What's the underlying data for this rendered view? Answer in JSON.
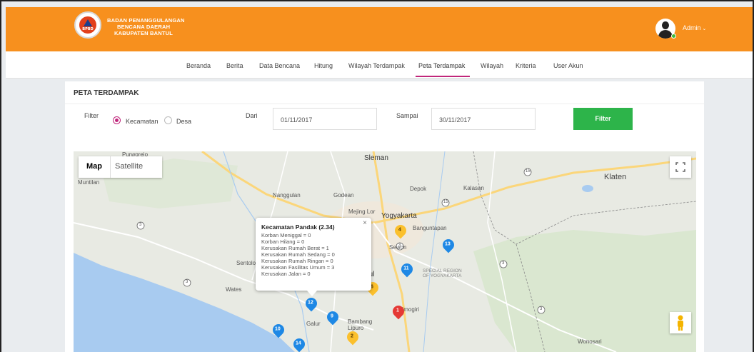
{
  "header": {
    "brand_lines": [
      "BADAN PENANGGULANGAN",
      "BENCANA DAERAH",
      "KABUPATEN BANTUL"
    ],
    "logo_text": "BPBD",
    "user_label": "Admin"
  },
  "nav": {
    "items": [
      {
        "label": "Beranda"
      },
      {
        "label": "Berita"
      },
      {
        "label": "Data Bencana"
      },
      {
        "label": "Hitung"
      },
      {
        "label": "Wilayah Terdampak"
      },
      {
        "label": "Peta Terdampak"
      },
      {
        "label": "Wilayah"
      },
      {
        "label": "Kriteria"
      },
      {
        "label": "User Akun"
      }
    ],
    "active": "Peta Terdampak",
    "accent_color": "#c0267b"
  },
  "page": {
    "title": "PETA TERDAMPAK",
    "filter_label": "Filter",
    "radio_kecamatan": "Kecamatan",
    "radio_desa": "Desa",
    "selected_level": "Kecamatan",
    "dari_label": "Dari",
    "dari_value": "01/11/2017",
    "sampai_label": "Sampai",
    "sampai_value": "30/11/2017",
    "filter_button": "Filter"
  },
  "map": {
    "type_map": "Map",
    "type_satellite": "Satellite",
    "selected_type": "Map",
    "places": [
      "Purworejo",
      "Muntilan",
      "Sleman",
      "Klaten",
      "Depok",
      "Kalasan",
      "Nanggulan",
      "Godean",
      "Mejing Lor",
      "Yogyakarta",
      "Banguntapan",
      "Sewon",
      "Sentolo",
      "Wates",
      "Bantul",
      "Galur",
      "Bambang Lipuro",
      "Imogiri",
      "Wonosari"
    ],
    "special_region": [
      "SPECIAL REGION",
      "OF YOGYAKARTA"
    ],
    "road_shields": [
      "15",
      "15",
      "3",
      "3",
      "3",
      "3",
      "3"
    ],
    "markers": [
      {
        "label": "4",
        "color": "yellow"
      },
      {
        "label": "13",
        "color": "blue"
      },
      {
        "label": "11",
        "color": "blue"
      },
      {
        "label": "6",
        "color": "yellow"
      },
      {
        "label": "12",
        "color": "blue"
      },
      {
        "label": "9",
        "color": "blue"
      },
      {
        "label": "1",
        "color": "red"
      },
      {
        "label": "10",
        "color": "blue"
      },
      {
        "label": "2",
        "color": "yellow"
      },
      {
        "label": "14",
        "color": "blue"
      }
    ],
    "marker_colors": {
      "blue": "#1e88e5",
      "yellow": "#fbc02d",
      "red": "#e53935"
    },
    "popup": {
      "title": "Kecamatan Pandak (2.34)",
      "lines": [
        "Korban Meniggal = 0",
        "Korban Hilang = 0",
        "Kerusakan Rumah Berat = 1",
        "Kerusakan Rumah Sedang = 0",
        "Kerusakan Rumah Ringan = 0",
        "Kerusakan Fasilitas Umum = 3",
        "Kerusakan Jalan = 0"
      ],
      "close": "×"
    }
  }
}
